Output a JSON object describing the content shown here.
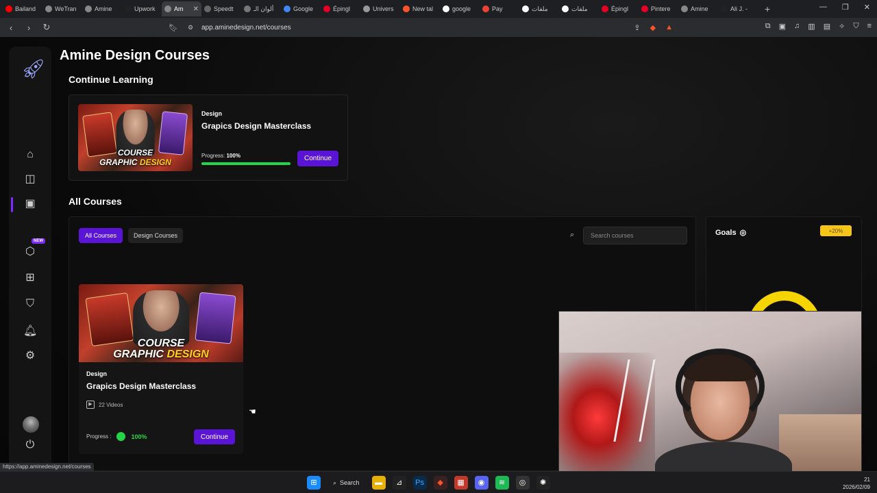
{
  "browser": {
    "tabs": [
      {
        "label": "Bailand",
        "color": "#ff0000"
      },
      {
        "label": "WeTran",
        "color": "#888888"
      },
      {
        "label": "Amine",
        "color": "#888888"
      },
      {
        "label": "Upwork",
        "color": "#222222"
      },
      {
        "label": "Am",
        "color": "#888888",
        "active": true
      },
      {
        "label": "Speedt",
        "color": "#666666"
      },
      {
        "label": "ألوان الـ",
        "color": "#777777"
      },
      {
        "label": "Google",
        "color": "#4285f4"
      },
      {
        "label": "Épingl",
        "color": "#e60023"
      },
      {
        "label": "Univers",
        "color": "#999999"
      },
      {
        "label": "New tal",
        "color": "#fb542b"
      },
      {
        "label": "google",
        "color": "#ffffff"
      },
      {
        "label": "Pay",
        "color": "#ea4335"
      },
      {
        "label": "ملفات",
        "color": "#ffffff"
      },
      {
        "label": "ملفات",
        "color": "#ffffff"
      },
      {
        "label": "Épingl",
        "color": "#e60023"
      },
      {
        "label": "Pintere",
        "color": "#e60023"
      },
      {
        "label": "Amine",
        "color": "#888888"
      },
      {
        "label": "Ali J. -",
        "color": "#222222"
      }
    ],
    "active_tab_close": "✕",
    "new_tab": "+",
    "url": "app.aminedesign.net/courses",
    "status_url": "https://app.aminedesign.net/courses"
  },
  "page": {
    "title": "Amine Design Courses",
    "continue_section_title": "Continue Learning",
    "continue_card": {
      "category": "Design",
      "course_title": "Grapics Design Masterclass",
      "progress_label": "Progress:",
      "progress_value": "100%",
      "progress_fraction": 1.0,
      "button": "Continue",
      "thumb_line1": "COURSE",
      "thumb_line2a": "GRAPHIC",
      "thumb_line2b": "DESIGN"
    },
    "all_courses_title": "All Courses",
    "filters": [
      "All Courses",
      "Design Courses"
    ],
    "search_placeholder": "Search courses",
    "course_card": {
      "category": "Design",
      "course_title": "Grapics Design Masterclass",
      "videos": "22 Videos",
      "progress_label": "Progress :",
      "progress_value": "100%",
      "button": "Continue",
      "thumb_line1": "COURSE",
      "thumb_line2a": "GRAPHIC",
      "thumb_line2b": "DESIGN"
    },
    "goals": {
      "title": "Goals",
      "badge": "+20%"
    },
    "sidebar_new_badge": "NEW"
  },
  "taskbar": {
    "search_label": "Search",
    "clock_line1": "21",
    "clock_line2": "2026/02/09"
  },
  "colors": {
    "accent_purple": "#5a14d6",
    "progress_green": "#22d64a",
    "goals_yellow": "#f5c518"
  }
}
